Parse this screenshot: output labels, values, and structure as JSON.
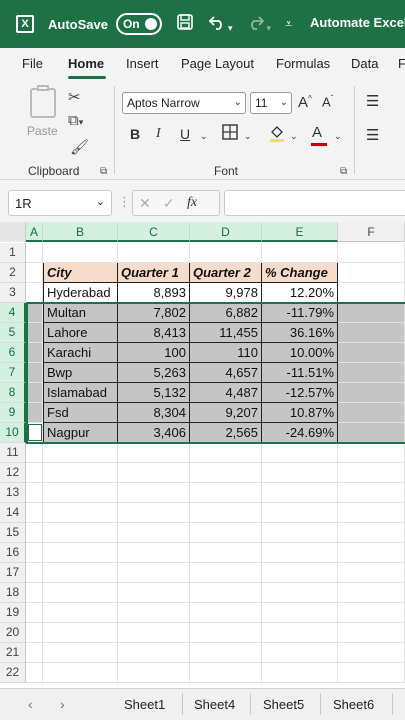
{
  "titlebar": {
    "logo": "X",
    "autosave_label": "AutoSave",
    "toggle_state": "On",
    "doc_title": "Automate Excel",
    "icons": [
      "excel-logo-icon",
      "save-icon",
      "undo-icon",
      "redo-icon",
      "customize-icon"
    ]
  },
  "menu": {
    "tabs": [
      "File",
      "Home",
      "Insert",
      "Page Layout",
      "Formulas",
      "Data",
      "F"
    ],
    "active": "Home"
  },
  "ribbon": {
    "clipboard_label": "Clipboard",
    "paste_label": "Paste",
    "font_label": "Font",
    "font_name": "Aptos Narrow",
    "font_size": "11",
    "bold": "B",
    "italic": "I",
    "underline": "U",
    "grow": "A^",
    "shrink": "A˅",
    "font_color_letter": "A",
    "accent_color": "#1e7145",
    "font_color": "#c00000"
  },
  "formula_bar": {
    "name_box": "1R",
    "fx": "fx",
    "cancel": "✕",
    "confirm": "✓",
    "value": ""
  },
  "grid": {
    "columns": [
      "A",
      "B",
      "C",
      "D",
      "E",
      "F"
    ],
    "row_numbers": [
      "1",
      "2",
      "3",
      "4",
      "5",
      "6",
      "7",
      "8",
      "9",
      "10",
      "11",
      "12",
      "13",
      "14",
      "15",
      "16",
      "17",
      "18",
      "19",
      "20",
      "21",
      "22"
    ],
    "table_headers": [
      "City",
      "Quarter 1",
      "Quarter 2",
      "% Change"
    ],
    "table_rows": [
      [
        "Hyderabad",
        "8,893",
        "9,978",
        "12.20%"
      ],
      [
        "Multan",
        "7,802",
        "6,882",
        "-11.79%"
      ],
      [
        "Lahore",
        "8,413",
        "11,455",
        "36.16%"
      ],
      [
        "Karachi",
        "100",
        "110",
        "10.00%"
      ],
      [
        "Bwp",
        "5,263",
        "4,657",
        "-11.51%"
      ],
      [
        "Islamabad",
        "5,132",
        "4,487",
        "-12.57%"
      ],
      [
        "Fsd",
        "8,304",
        "9,207",
        "10.87%"
      ],
      [
        "Nagpur",
        "3,406",
        "2,565",
        "-24.69%"
      ]
    ],
    "header_fill": "#f8dccb",
    "selected_fill": "#c5c5c5"
  },
  "sheets": {
    "tabs": [
      "Sheet1",
      "Sheet4",
      "Sheet5",
      "Sheet6"
    ]
  }
}
